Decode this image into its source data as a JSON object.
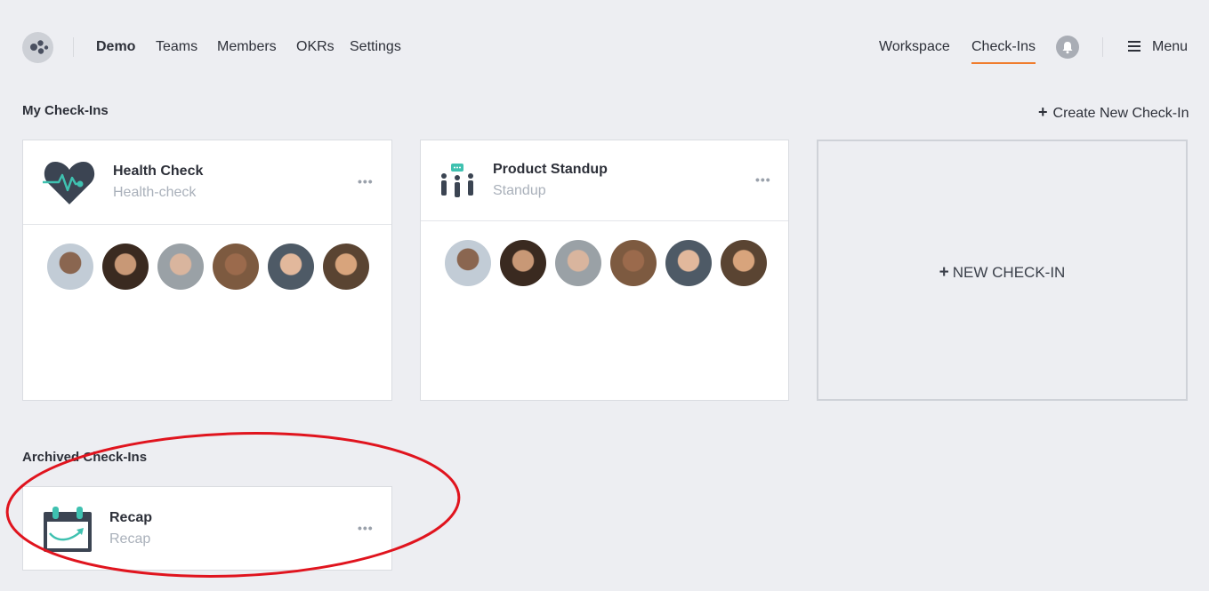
{
  "nav": {
    "brand": "Demo",
    "links": [
      "Teams",
      "Members",
      "OKRs",
      "Settings"
    ],
    "right_links": [
      "Workspace",
      "Check-Ins"
    ],
    "active": "Check-Ins",
    "menu_label": "Menu"
  },
  "my_checkins": {
    "title": "My Check-Ins",
    "create_label": "Create New Check-In",
    "cards": [
      {
        "title": "Health Check",
        "subtitle": "Health-check",
        "icon": "heart-pulse-icon",
        "member_count": 6
      },
      {
        "title": "Product Standup",
        "subtitle": "Standup",
        "icon": "standup-people-icon",
        "member_count": 6
      }
    ],
    "new_card_label": "NEW CHECK-IN"
  },
  "archived": {
    "title": "Archived Check-Ins",
    "cards": [
      {
        "title": "Recap",
        "subtitle": "Recap",
        "icon": "calendar-recap-icon"
      }
    ]
  },
  "more_label": "•••",
  "colors": {
    "accent": "#f07c2d",
    "teal": "#3fc1b0",
    "dark": "#3b4452",
    "annotation": "#e0141e"
  }
}
